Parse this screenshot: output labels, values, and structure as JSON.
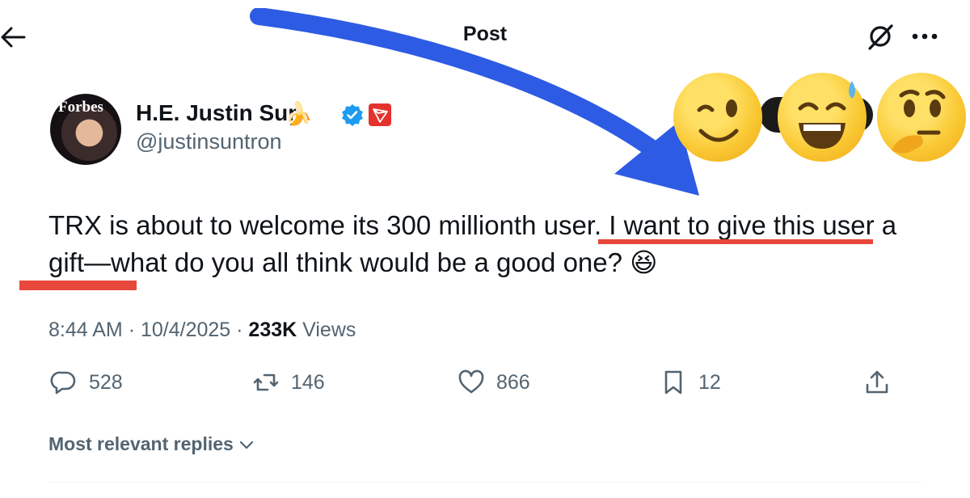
{
  "header": {
    "title": "Post",
    "back_icon": "arrow-left-icon",
    "grok_icon": "grok-icon",
    "more_icon": "more-horizontal-icon"
  },
  "author": {
    "name": "H.E. Justin Sun",
    "name_emoji": "🍌",
    "handle": "@justinsuntron",
    "avatar_label": "Forbes",
    "badges": [
      "verified-check-icon",
      "tron-logo-icon"
    ]
  },
  "tweet": {
    "text": "TRX is about to welcome its 300 millionth user. I want to give this user a gift—what do you all think would be a good one? 😆",
    "time": "8:44 AM",
    "date": "10/4/2025",
    "views_count": "233K",
    "views_label": "Views",
    "separator": "·"
  },
  "actions": {
    "replies": "528",
    "reposts": "146",
    "likes": "866",
    "bookmarks": "12"
  },
  "replies_sort": {
    "label": "Most relevant replies"
  },
  "colors": {
    "annotation_red": "#e8473b",
    "arrow_blue": "#2d5be3",
    "muted": "#536471",
    "verified_blue": "#1d9bf0",
    "tron_red": "#e5322d"
  },
  "overlay_emojis": [
    "winking-face",
    "grinning-sweat-face",
    "thinking-face"
  ]
}
